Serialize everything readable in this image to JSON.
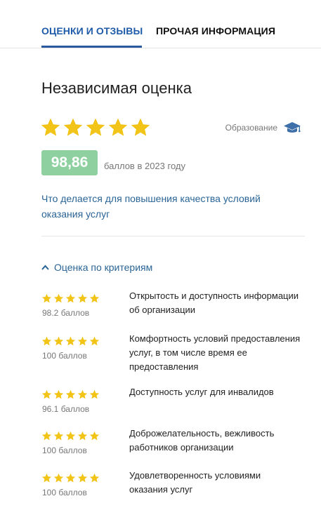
{
  "tabs": [
    {
      "label": "ОЦЕНКИ И ОТЗЫВЫ",
      "active": true
    },
    {
      "label": "ПРОЧАЯ ИНФОРМАЦИЯ",
      "active": false
    }
  ],
  "rating": {
    "title": "Независимая оценка",
    "stars": 5,
    "category_label": "Образование",
    "category_icon": "graduation-cap-icon",
    "score": "98,86",
    "score_caption": "баллов в 2023 году",
    "improve_link": "Что делается для повышения качества условий оказания услуг"
  },
  "criteria": {
    "toggle_label": "Оценка по критериям",
    "items": [
      {
        "stars": 5,
        "points": "98.2 баллов",
        "text": "Открытость и доступность информации об организации"
      },
      {
        "stars": 5,
        "points": "100 баллов",
        "text": "Комфортность условий предоставления услуг, в том числе время ее предоставления"
      },
      {
        "stars": 5,
        "points": "96.1 баллов",
        "text": "Доступность услуг для инвалидов"
      },
      {
        "stars": 5,
        "points": "100 баллов",
        "text": "Доброжелательность, вежливость работников организации"
      },
      {
        "stars": 5,
        "points": "100 баллов",
        "text": "Удовлетворенность условиями оказания услуг"
      }
    ]
  },
  "colors": {
    "accent": "#2c5aa0",
    "link": "#2a6496",
    "star": "#f2c418",
    "score_badge": "#8fd0a0"
  }
}
